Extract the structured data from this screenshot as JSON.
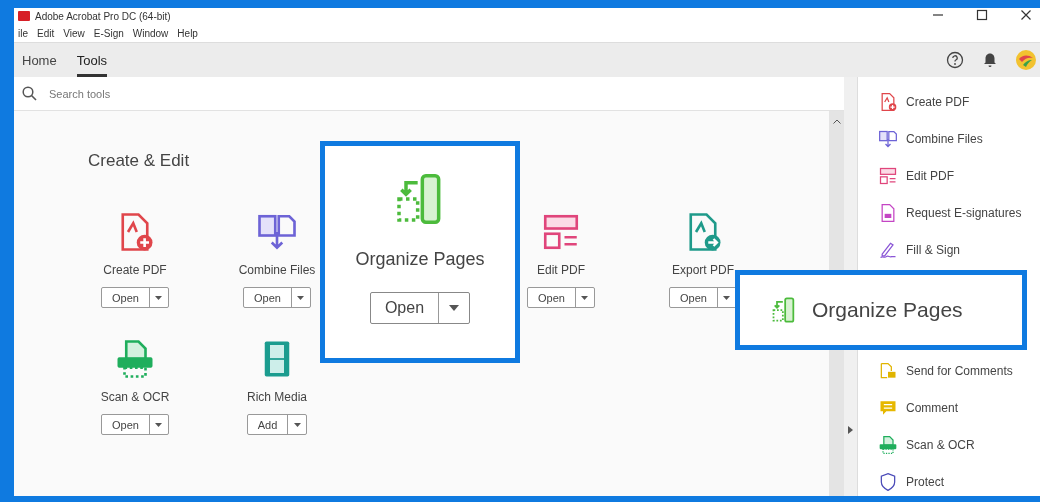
{
  "window": {
    "title": "Adobe Acrobat Pro DC (64-bit)"
  },
  "menu": [
    "ile",
    "Edit",
    "View",
    "E-Sign",
    "Window",
    "Help"
  ],
  "tabs": [
    {
      "label": "Home",
      "selected": false
    },
    {
      "label": "Tools",
      "selected": true
    }
  ],
  "search": {
    "placeholder": "Search tools"
  },
  "section": {
    "title": "Create & Edit"
  },
  "tools": [
    {
      "label": "Create PDF",
      "button": "Open"
    },
    {
      "label": "Combine Files",
      "button": "Open"
    },
    {
      "label": "Edit PDF",
      "button": "Open"
    },
    {
      "label": "Export PDF",
      "button": "Open"
    },
    {
      "label": "Scan & OCR",
      "button": "Open"
    },
    {
      "label": "Rich Media",
      "button": "Add"
    }
  ],
  "tool_callout": {
    "label": "Organize Pages",
    "button": "Open"
  },
  "right_panel": {
    "items_above": [
      "Create PDF",
      "Combine Files",
      "Edit PDF",
      "Request E-signatures",
      "Fill & Sign"
    ],
    "callout": {
      "label": "Organize Pages"
    },
    "items_below": [
      "Send for Comments",
      "Comment",
      "Scan & OCR",
      "Protect"
    ]
  }
}
